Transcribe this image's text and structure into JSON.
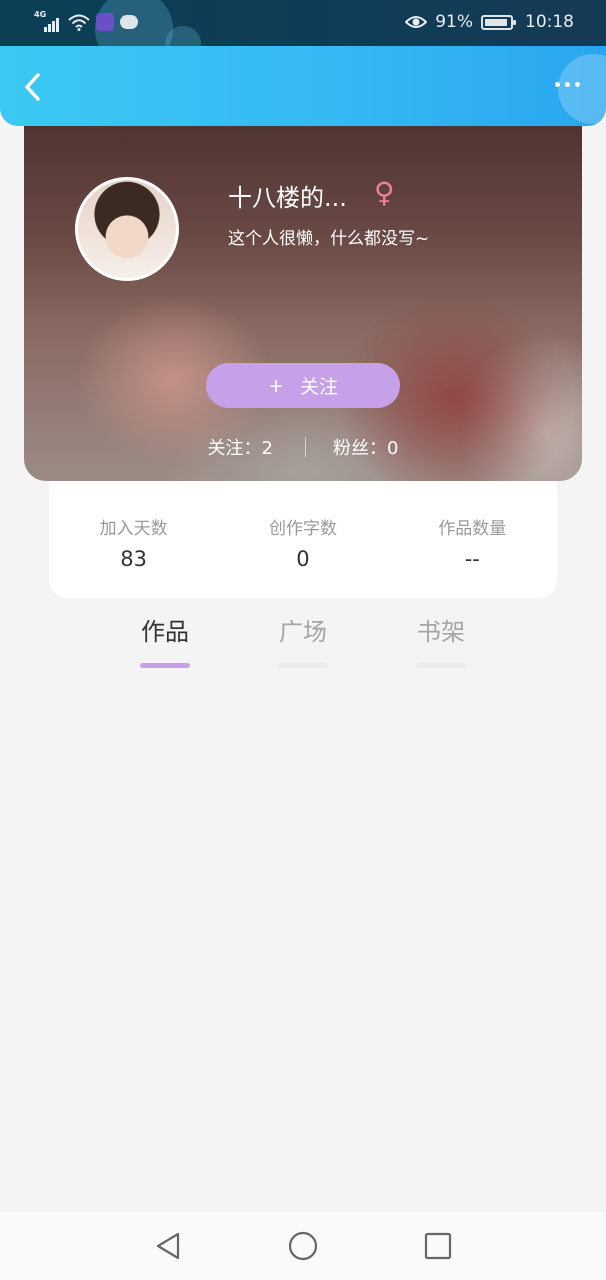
{
  "status_bar": {
    "network": "4G",
    "battery": "91%",
    "time": "10:18"
  },
  "header": {
    "back_icon": "chevron-left-icon",
    "more_icon": "more-horizontal-icon"
  },
  "profile": {
    "name": "十八楼的...",
    "gender_symbol": "♀",
    "bio": "这个人很懒，什么都没写~",
    "follow_button": {
      "plus": "+",
      "label": "关注"
    },
    "following": "关注：2",
    "fans": "粉丝：0"
  },
  "stats": [
    {
      "label": "加入天数",
      "value": "83"
    },
    {
      "label": "创作字数",
      "value": "0"
    },
    {
      "label": "作品数量",
      "value": "--"
    }
  ],
  "tabs": [
    {
      "label": "作品",
      "active": true
    },
    {
      "label": "广场",
      "active": false
    },
    {
      "label": "书架",
      "active": false
    }
  ],
  "colors": {
    "header": "#35b8f4",
    "accent": "#c6a0e8",
    "gender": "#f07f9a"
  }
}
